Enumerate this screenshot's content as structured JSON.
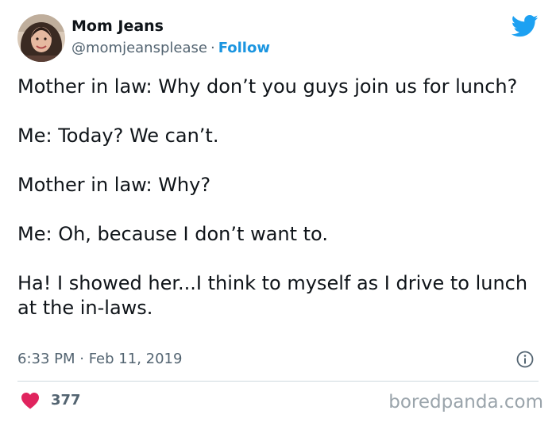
{
  "header": {
    "display_name": "Mom Jeans",
    "handle": "@momjeansplease",
    "separator": "·",
    "follow_label": "Follow"
  },
  "icons": {
    "avatar": "avatar-photo",
    "brand": "twitter-bird-icon",
    "info": "info-icon",
    "like": "heart-icon"
  },
  "tweet": {
    "paragraphs": [
      "Mother in law: Why don’t you guys join us for lunch?",
      "Me: Today? We can’t.",
      "Mother in law: Why?",
      "Me: Oh, because I don’t want to.",
      "Ha! I showed her...I think to myself as I drive to lunch at the in-laws."
    ],
    "timestamp": "6:33 PM · Feb 11, 2019"
  },
  "footer": {
    "like_count": "377",
    "watermark": "boredpanda.com"
  },
  "colors": {
    "accent": "#1b95e0",
    "heart": "#e0245e",
    "text": "#0f1419",
    "secondary": "#536471"
  }
}
